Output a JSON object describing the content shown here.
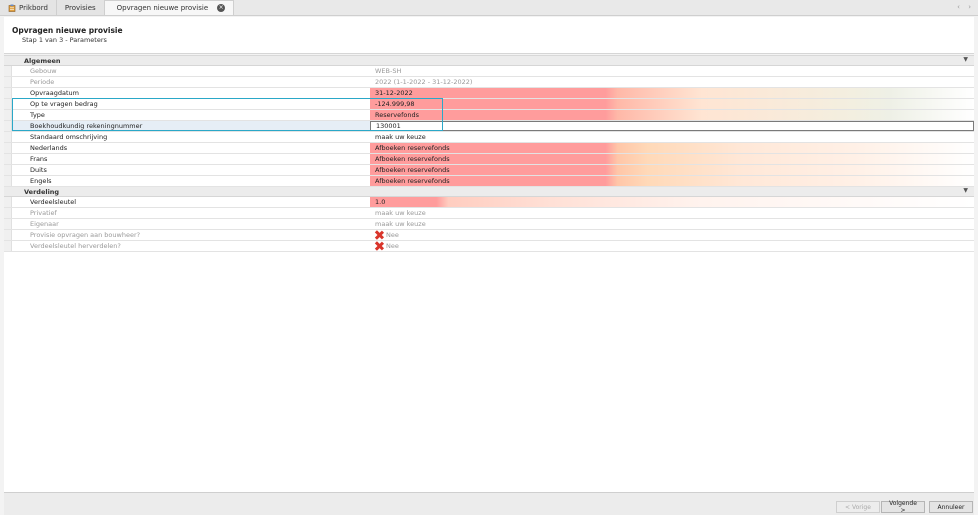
{
  "tabs": [
    {
      "label": "Prikbord",
      "icon": "clipboard-icon"
    },
    {
      "label": "Provisies"
    },
    {
      "label": "Opvragen nieuwe provisie",
      "active": true,
      "closable": true
    }
  ],
  "header": {
    "title": "Opvragen nieuwe provisie",
    "step": "Stap 1 van 3 - Parameters"
  },
  "sections": {
    "algemeen": {
      "title": "Algemeen",
      "rows": {
        "gebouw": {
          "label": "Gebouw",
          "value": "WEB-SH"
        },
        "periode": {
          "label": "Periode",
          "value": "2022 (1-1-2022 - 31-12-2022)"
        },
        "opvraagdatum": {
          "label": "Opvraagdatum",
          "value": "31-12-2022"
        },
        "bedrag": {
          "label": "Op te vragen bedrag",
          "value": "-124.999,98"
        },
        "type": {
          "label": "Type",
          "value": "Reservefonds"
        },
        "rekening": {
          "label": "Boekhoudkundig rekeningnummer",
          "value": "130001"
        },
        "omschrijving": {
          "label": "Standaard omschrijving",
          "value": "maak uw keuze"
        },
        "nederlands": {
          "label": "Nederlands",
          "value": "Afboeken reservefonds"
        },
        "frans": {
          "label": "Frans",
          "value": "Afboeken reservefonds"
        },
        "duits": {
          "label": "Duits",
          "value": "Afboeken reservefonds"
        },
        "engels": {
          "label": "Engels",
          "value": "Afboeken reservefonds"
        }
      }
    },
    "verdeling": {
      "title": "Verdeling",
      "rows": {
        "verdeelsleutel": {
          "label": "Verdeelsleutel",
          "value": "1.0"
        },
        "privatief": {
          "label": "Privatief",
          "value": "maak uw keuze"
        },
        "eigenaar": {
          "label": "Eigenaar",
          "value": "maak uw keuze"
        },
        "bouwheer": {
          "label": "Provisie opvragen aan bouwheer?",
          "value": "Nee"
        },
        "herverdelen": {
          "label": "Verdeelsleutel herverdelen?",
          "value": "Nee"
        }
      }
    }
  },
  "footer": {
    "prev": "< Vorige",
    "next": "Volgende >",
    "cancel": "Annuleer"
  },
  "colors": {
    "error": "#ff9c9c",
    "highlight": "#2aa8c8",
    "deny": "#d9352b"
  }
}
